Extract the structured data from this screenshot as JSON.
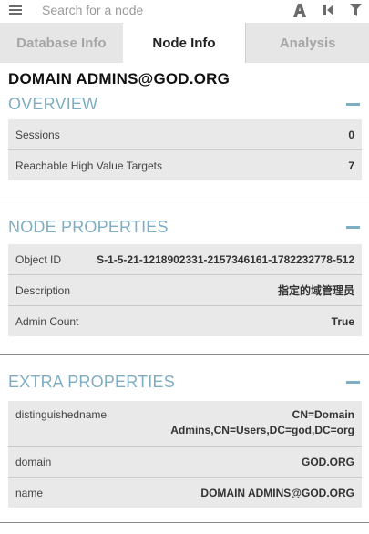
{
  "search": {
    "placeholder": "Search for a node"
  },
  "toolbar": {
    "icons": [
      "menu-icon",
      "pathfinding-icon",
      "back-icon",
      "filter-icon"
    ]
  },
  "tabs": [
    {
      "label": "Database Info",
      "active": false
    },
    {
      "label": "Node Info",
      "active": true
    },
    {
      "label": "Analysis",
      "active": false
    }
  ],
  "node": {
    "title": "DOMAIN ADMINS@GOD.ORG"
  },
  "overview": {
    "title": "OVERVIEW",
    "rows": [
      {
        "key": "Sessions",
        "value": "0"
      },
      {
        "key": "Reachable High Value Targets",
        "value": "7"
      }
    ]
  },
  "node_properties": {
    "title": "NODE PROPERTIES",
    "rows": [
      {
        "key": "Object ID",
        "value": "S-1-5-21-1218902331-2157346161-1782232778-512"
      },
      {
        "key": "Description",
        "value": "指定的域管理员"
      },
      {
        "key": "Admin Count",
        "value": "True"
      }
    ]
  },
  "extra_properties": {
    "title": "EXTRA PROPERTIES",
    "rows": [
      {
        "key": "distinguishedname",
        "value": "CN=Domain Admins,CN=Users,DC=god,DC=org"
      },
      {
        "key": "domain",
        "value": "GOD.ORG"
      },
      {
        "key": "name",
        "value": "DOMAIN ADMINS@GOD.ORG"
      }
    ]
  },
  "colors": {
    "accent": "#7faec2",
    "tab_inactive_bg": "#e6e6e6",
    "table_bg": "#e9e9e9"
  }
}
